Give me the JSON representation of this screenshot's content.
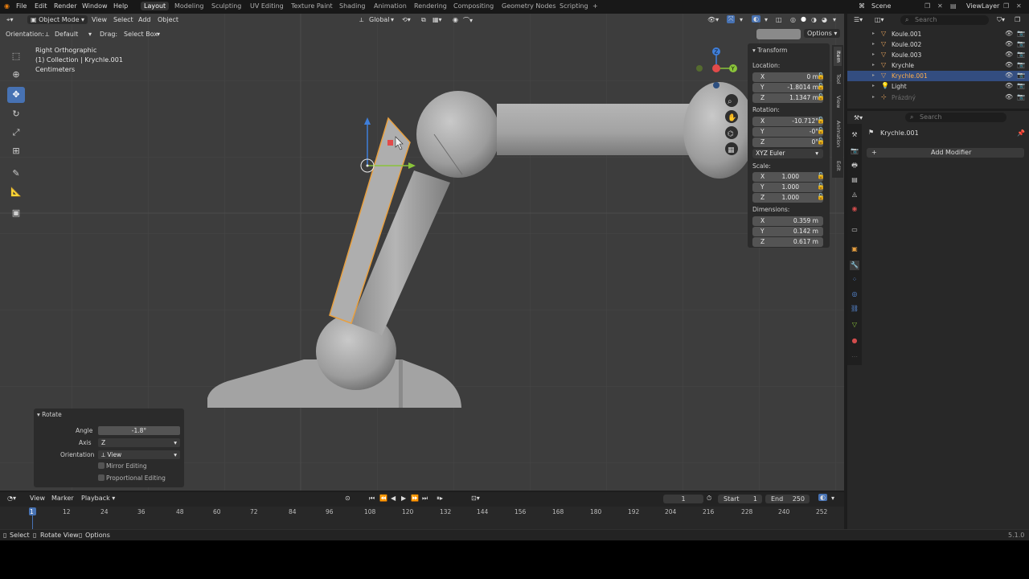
{
  "menu": {
    "file": "File",
    "edit": "Edit",
    "render": "Render",
    "window": "Window",
    "help": "Help"
  },
  "workspaces": [
    "Layout",
    "Modeling",
    "Sculpting",
    "UV Editing",
    "Texture Paint",
    "Shading",
    "Animation",
    "Rendering",
    "Compositing",
    "Geometry Nodes",
    "Scripting"
  ],
  "workspace_add": "+",
  "scene": {
    "name": "Scene",
    "view_layer": "ViewLayer"
  },
  "viewport_header": {
    "mode": "Object Mode",
    "view": "View",
    "select": "Select",
    "add": "Add",
    "object": "Object",
    "transform_orientation": "Global"
  },
  "tool_header": {
    "orientation_label": "Orientation:",
    "orientation_value": "Default",
    "drag_label": "Drag:",
    "drag_value": "Select Box",
    "options": "Options"
  },
  "overlay_info": {
    "view_name": "Right Orthographic",
    "collection": "(1) Collection | Krychle.001",
    "units": "Centimeters"
  },
  "transform_panel": {
    "header": "Transform",
    "location_label": "Location:",
    "location": [
      {
        "axis": "X",
        "value": "0 m"
      },
      {
        "axis": "Y",
        "value": "-1.8014 m"
      },
      {
        "axis": "Z",
        "value": "1.1347 m"
      }
    ],
    "rotation_label": "Rotation:",
    "rotation": [
      {
        "axis": "X",
        "value": "-10.712°"
      },
      {
        "axis": "Y",
        "value": "-0°"
      },
      {
        "axis": "Z",
        "value": "0°"
      }
    ],
    "rotation_mode": "XYZ Euler",
    "scale_label": "Scale:",
    "scale": [
      {
        "axis": "X",
        "value": "1.000"
      },
      {
        "axis": "Y",
        "value": "1.000"
      },
      {
        "axis": "Z",
        "value": "1.000"
      }
    ],
    "dimensions_label": "Dimensions:",
    "dimensions": [
      {
        "axis": "X",
        "value": "0.359 m"
      },
      {
        "axis": "Y",
        "value": "0.142 m"
      },
      {
        "axis": "Z",
        "value": "0.617 m"
      }
    ]
  },
  "side_tabs": [
    "Item",
    "Tool",
    "View",
    "Animation",
    "Edit"
  ],
  "redo_panel": {
    "title": "Rotate",
    "angle_label": "Angle",
    "angle_value": "-1.8°",
    "axis_label": "Axis",
    "axis_value": "Z",
    "orientation_label": "Orientation",
    "orientation_value": "View",
    "mirror_label": "Mirror Editing",
    "proportional_label": "Proportional Editing"
  },
  "outliner": {
    "search_placeholder": "Search",
    "items": [
      {
        "name": "Koule.001",
        "selected": false,
        "dim": false
      },
      {
        "name": "Koule.002",
        "selected": false,
        "dim": false
      },
      {
        "name": "Koule.003",
        "selected": false,
        "dim": false
      },
      {
        "name": "Krychle",
        "selected": false,
        "dim": false
      },
      {
        "name": "Krychle.001",
        "selected": true,
        "dim": false
      },
      {
        "name": "Light",
        "selected": false,
        "dim": false
      },
      {
        "name": "Prázdný",
        "selected": false,
        "dim": true
      }
    ]
  },
  "properties": {
    "search_placeholder": "Search",
    "object_name": "Krychle.001",
    "add_modifier": "Add Modifier"
  },
  "timeline": {
    "view": "View",
    "marker": "Marker",
    "playback": "Playback",
    "current_frame": "1",
    "start_label": "Start",
    "start_value": "1",
    "end_label": "End",
    "end_value": "250",
    "ticks": [
      "1",
      "12",
      "24",
      "36",
      "48",
      "60",
      "72",
      "84",
      "96",
      "108",
      "120",
      "132",
      "144",
      "156",
      "168",
      "180",
      "192",
      "204",
      "216",
      "228",
      "240",
      "252"
    ]
  },
  "statusbar": {
    "select": "Select",
    "rotate_view": "Rotate View",
    "options": "Options",
    "version": "5.1.0"
  },
  "colors": {
    "accent": "#4772b3",
    "selection_outline": "#e8a040",
    "viewport_bg": "#3d3d3d",
    "gizmo_x": "#e24a4a",
    "gizmo_y": "#8ac43a",
    "gizmo_z": "#3f7fdb"
  }
}
